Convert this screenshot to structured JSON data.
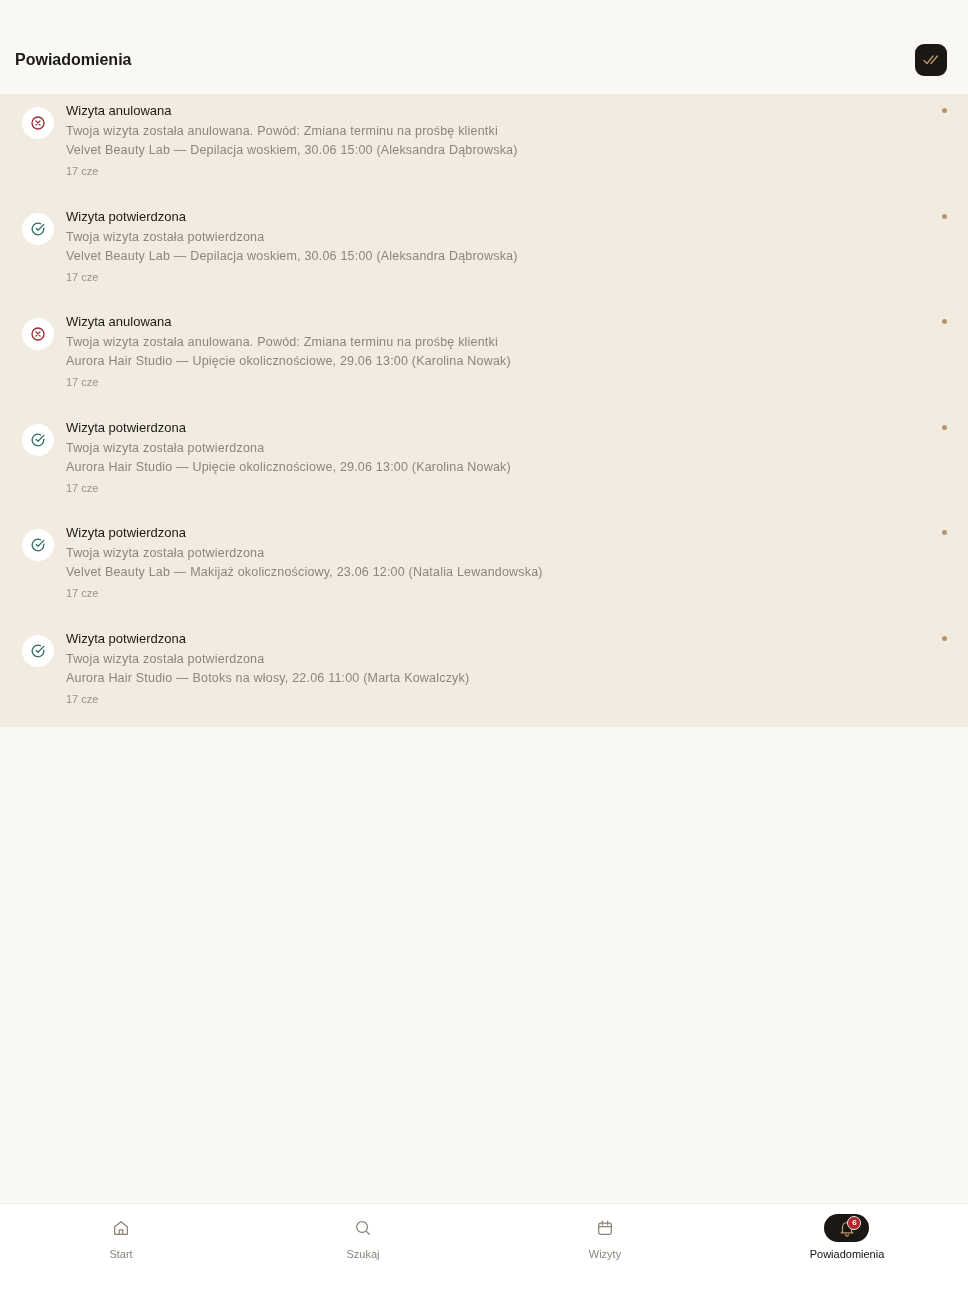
{
  "header": {
    "title": "Powiadomienia"
  },
  "notifications": [
    {
      "kind": "cancelled",
      "title": "Wizyta anulowana",
      "message": "Twoja wizyta została anulowana. Powód: Zmiana terminu na prośbę klientki",
      "details": "Velvet Beauty Lab — Depilacja woskiem, 30.06 15:00 (Aleksandra Dąbrowska)",
      "time": "17 cze",
      "unread": true
    },
    {
      "kind": "confirmed",
      "title": "Wizyta potwierdzona",
      "message": "Twoja wizyta została potwierdzona",
      "details": "Velvet Beauty Lab — Depilacja woskiem, 30.06 15:00 (Aleksandra Dąbrowska)",
      "time": "17 cze",
      "unread": true
    },
    {
      "kind": "cancelled",
      "title": "Wizyta anulowana",
      "message": "Twoja wizyta została anulowana. Powód: Zmiana terminu na prośbę klientki",
      "details": "Aurora Hair Studio — Upięcie okolicznościowe, 29.06 13:00 (Karolina Nowak)",
      "time": "17 cze",
      "unread": true
    },
    {
      "kind": "confirmed",
      "title": "Wizyta potwierdzona",
      "message": "Twoja wizyta została potwierdzona",
      "details": "Aurora Hair Studio — Upięcie okolicznościowe, 29.06 13:00 (Karolina Nowak)",
      "time": "17 cze",
      "unread": true
    },
    {
      "kind": "confirmed",
      "title": "Wizyta potwierdzona",
      "message": "Twoja wizyta została potwierdzona",
      "details": "Velvet Beauty Lab — Makijaż okolicznościowy, 23.06 12:00 (Natalia Lewandowska)",
      "time": "17 cze",
      "unread": true
    },
    {
      "kind": "confirmed",
      "title": "Wizyta potwierdzona",
      "message": "Twoja wizyta została potwierdzona",
      "details": "Aurora Hair Studio — Botoks na włosy, 22.06 11:00 (Marta Kowalczyk)",
      "time": "17 cze",
      "unread": true
    }
  ],
  "bottom_nav": [
    {
      "kind": "home",
      "label": "Start",
      "selected": false
    },
    {
      "kind": "search",
      "label": "Szukaj",
      "selected": false
    },
    {
      "kind": "calendar",
      "label": "Wizyty",
      "selected": false
    },
    {
      "kind": "bell",
      "label": "Powiadomienia",
      "selected": true,
      "badge": "6"
    }
  ]
}
